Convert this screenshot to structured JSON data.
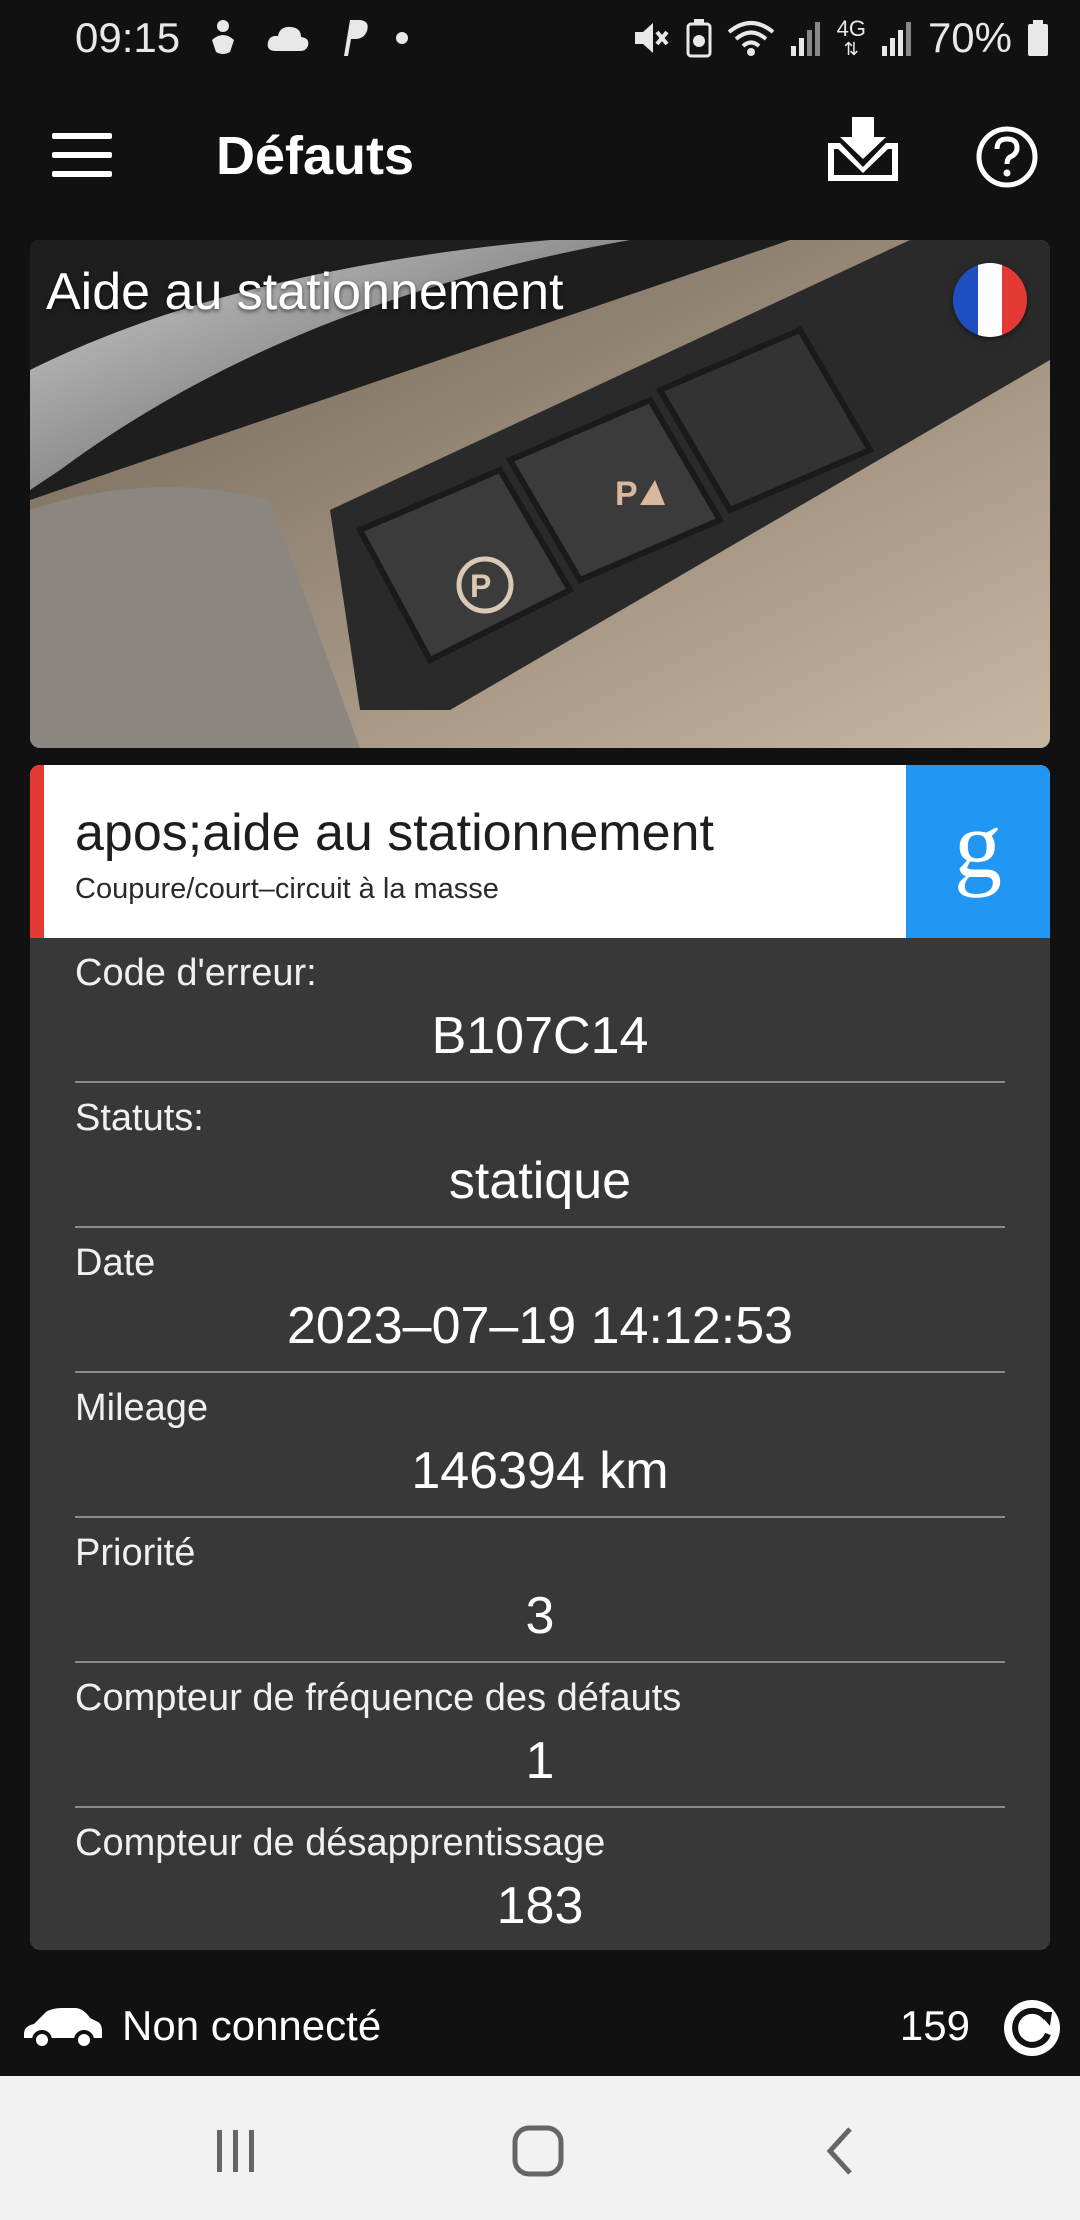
{
  "status_bar": {
    "time": "09:15",
    "network_type": "4G",
    "battery": "70%"
  },
  "app_bar": {
    "title": "Défauts"
  },
  "module": {
    "title": "Aide au stationnement",
    "language_flag": "france-flag"
  },
  "fault": {
    "name": "apos;aide au stationnement",
    "description": "Coupure/court–circuit à la masse",
    "search_label": "g",
    "accent_color": "#e53935",
    "search_color": "#2196f3",
    "details": [
      {
        "label": "Code d'erreur:",
        "value": "B107C14"
      },
      {
        "label": "Statuts:",
        "value": "statique"
      },
      {
        "label": "Date",
        "value": "2023–07–19 14:12:53"
      },
      {
        "label": "Mileage",
        "value": "146394 km"
      },
      {
        "label": "Priorité",
        "value": "3"
      },
      {
        "label": "Compteur de fréquence des défauts",
        "value": "1"
      },
      {
        "label": "Compteur de désapprentissage",
        "value": "183"
      }
    ]
  },
  "connection": {
    "status": "Non connecté",
    "count": "159"
  },
  "icons": {
    "menu": "menu-icon",
    "download": "download-inbox-icon",
    "help": "help-icon",
    "car": "car-icon",
    "refresh": "refresh-icon",
    "nav_recents": "recents-icon",
    "nav_home": "home-icon",
    "nav_back": "back-icon"
  }
}
